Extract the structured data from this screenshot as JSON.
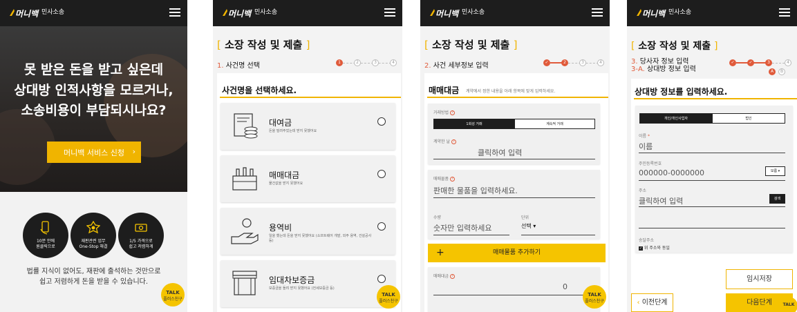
{
  "brand": {
    "logo": "머니백",
    "sub": "민사소송"
  },
  "screen1": {
    "hero_lines": [
      "못 받은 돈을 받고 싶은데",
      "상대방 인적사항을 모르거나,",
      "소송비용이 부담되시나요?"
    ],
    "cta_label": "머니백 서비스 신청",
    "features": [
      {
        "icon": "phone-hand-icon",
        "text": [
          "10분 안에",
          "원클릭으로"
        ]
      },
      {
        "icon": "badge-icon",
        "text": [
          "재판관련 업무",
          "One-Stop 해결"
        ]
      },
      {
        "icon": "money-icon",
        "text": [
          "1/5 가격으로",
          "쉽고 저렴하게"
        ]
      }
    ],
    "desc_lines": [
      "법률 지식이 없어도, 재판에 출석하는 것만으로",
      "쉽고 저렴하게 돈을 받을 수 있습니다."
    ],
    "talk_label": "TALK",
    "talk_sub": "플러스친구"
  },
  "screen2": {
    "title": "소장 작성 및 제출",
    "step_num": "1.",
    "step_text": "사건명 선택",
    "steps": [
      "1",
      "2",
      "3",
      "4"
    ],
    "heading": "사건명을 선택하세요.",
    "items": [
      {
        "icon": "money-stack-icon",
        "name": "대여금",
        "desc": "돈을 빌려주었는데 받지 못했어요"
      },
      {
        "icon": "bottles-icon",
        "name": "매매대금",
        "desc": "물건값을 받지 못했어요"
      },
      {
        "icon": "hand-coin-icon",
        "name": "용역비",
        "desc": "일을 했는데 돈을 받지 못했어요 (소프트웨어 개발, 외주 용역, 건설공사 등)"
      },
      {
        "icon": "storefront-icon",
        "name": "임대차보증금",
        "desc": "보증금을 돌려 받지 못했어요 (전세보증금 등)"
      }
    ]
  },
  "screen3": {
    "title": "소장 작성 및 제출",
    "step_num": "2.",
    "step_text": "사건 세부정보 입력",
    "steps": [
      "✓",
      "2",
      "3",
      "4"
    ],
    "heading": "매매대금",
    "heading_sub": "계약에서 정한 내용을 아래 항목에 맞게 입력하세요.",
    "deal_label": "거래방법",
    "seg_left": "1회성 거래",
    "seg_right": "계속적 거래",
    "date_label": "계약한 날",
    "date_placeholder": "클릭하여 입력",
    "goods_label": "매매물품",
    "goods_placeholder": "판매한 물품을 입력하세요.",
    "qty_label": "수량",
    "qty_placeholder": "숫자만 입력하세요",
    "unit_label": "단위",
    "unit_value": "선택",
    "add_label": "매매물품 추가하기",
    "price_label": "매매대금",
    "price_value": "0"
  },
  "screen4": {
    "title": "소장 작성 및 제출",
    "step_num": "3.",
    "step_text": "당사자 정보 입력",
    "step_num2": "3-A.",
    "step_text2": "상대방 정보 입력",
    "steps": [
      "✓",
      "✓",
      "3",
      "4"
    ],
    "substeps": [
      "A",
      "B"
    ],
    "heading": "상대방 정보를 입력하세요.",
    "seg_left": "개인/개인사업자",
    "seg_right": "법인",
    "name_label": "이름",
    "name_placeholder": "이름",
    "id_label": "주민등록번호",
    "id_placeholder": "000000-0000000",
    "id_btn": "모름",
    "addr_label": "주소",
    "addr_placeholder": "클릭하여 입력",
    "addr_btn": "검색",
    "mail_label": "송달주소",
    "mail_check": "위 주소와 동일",
    "save_btn": "임시저장",
    "prev_btn": "이전단계",
    "next_btn": "다음단계"
  },
  "colors": {
    "accent": "#f5c400",
    "dark": "#1d1d1d",
    "step": "#e05a3a"
  }
}
